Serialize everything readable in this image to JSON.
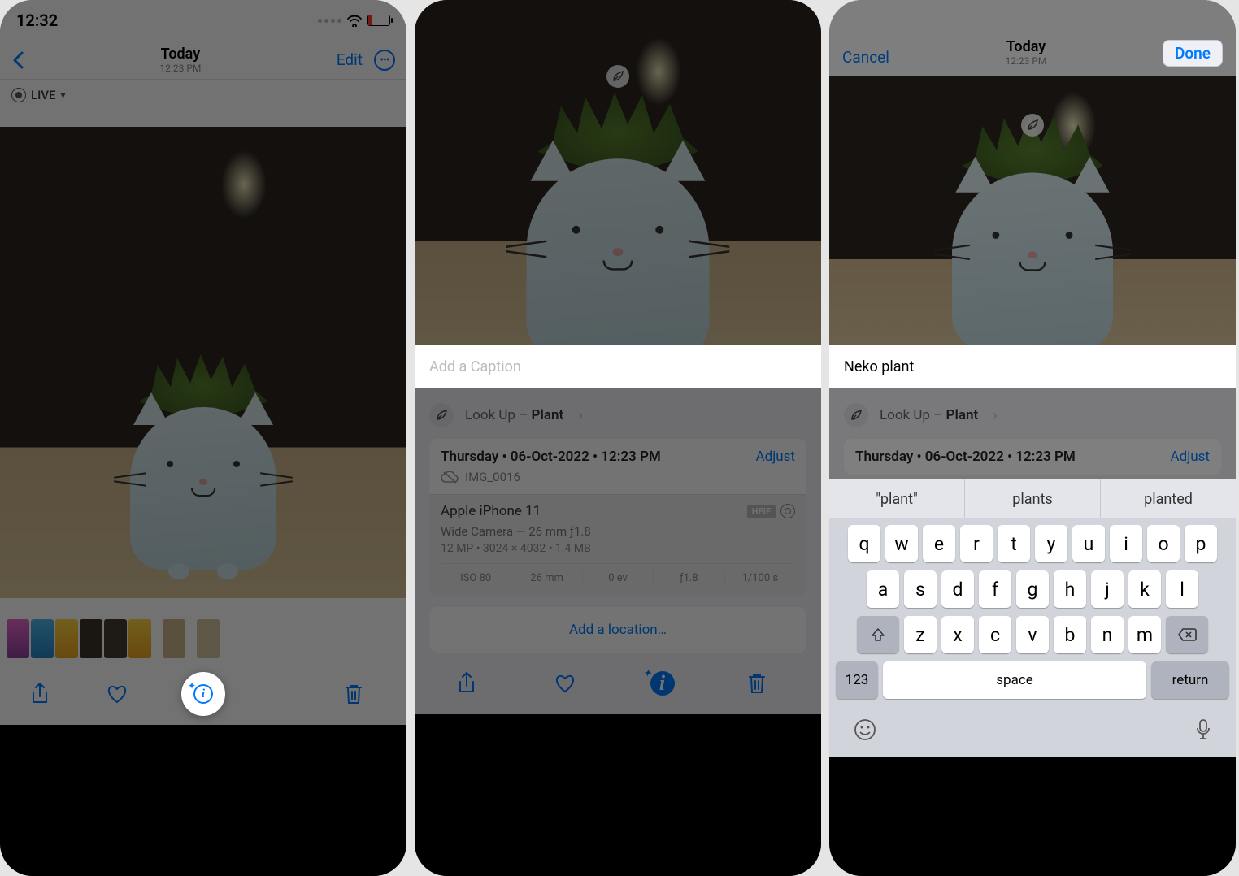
{
  "screen1": {
    "status": {
      "time": "12:32"
    },
    "nav": {
      "title": "Today",
      "subtitle": "12:23 PM",
      "edit": "Edit"
    },
    "live_badge": "LIVE"
  },
  "screen2": {
    "caption_placeholder": "Add a Caption",
    "lookup_prefix": "Look Up – ",
    "lookup_subject": "Plant",
    "info": {
      "date_line": "Thursday • 06-Oct-2022 • 12:23 PM",
      "adjust": "Adjust",
      "filename": "IMG_0016",
      "device": "Apple iPhone 11",
      "format_badge": "HEIF",
      "camera": "Wide Camera — 26 mm ƒ1.8",
      "meta": "12 MP  •  3024 × 4032  •  1.4 MB",
      "exif": {
        "iso": "ISO 80",
        "focal": "26 mm",
        "ev": "0 ev",
        "aperture": "ƒ1.8",
        "shutter": "1/100 s"
      },
      "add_location": "Add a location…"
    }
  },
  "screen3": {
    "cancel": "Cancel",
    "done": "Done",
    "nav": {
      "title": "Today",
      "subtitle": "12:23 PM"
    },
    "caption_value": "Neko plant",
    "lookup_prefix": "Look Up – ",
    "lookup_subject": "Plant",
    "info": {
      "date_line": "Thursday • 06-Oct-2022 • 12:23 PM",
      "adjust": "Adjust"
    },
    "keyboard": {
      "suggestions": [
        "\"plant\"",
        "plants",
        "planted"
      ],
      "row1": [
        "q",
        "w",
        "e",
        "r",
        "t",
        "y",
        "u",
        "i",
        "o",
        "p"
      ],
      "row2": [
        "a",
        "s",
        "d",
        "f",
        "g",
        "h",
        "j",
        "k",
        "l"
      ],
      "row3": [
        "z",
        "x",
        "c",
        "v",
        "b",
        "n",
        "m"
      ],
      "numeric": "123",
      "space": "space",
      "ret": "return"
    }
  }
}
